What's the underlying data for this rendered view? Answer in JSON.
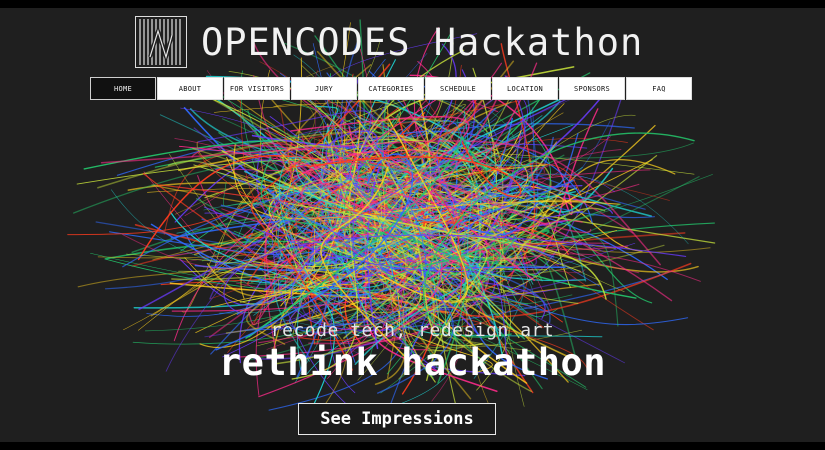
{
  "header": {
    "logo_icon": "striped-square-logo-icon",
    "title": "OPENCODES Hackathon"
  },
  "nav": {
    "items": [
      {
        "label": "HOME",
        "active": true
      },
      {
        "label": "ABOUT",
        "active": false
      },
      {
        "label": "FOR VISITORS",
        "active": false
      },
      {
        "label": "JURY",
        "active": false
      },
      {
        "label": "CATEGORIES",
        "active": false
      },
      {
        "label": "SCHEDULE",
        "active": false
      },
      {
        "label": "LOCATION",
        "active": false
      },
      {
        "label": "SPONSORS",
        "active": false
      },
      {
        "label": "FAQ",
        "active": false
      }
    ]
  },
  "hero": {
    "tagline": "recode tech, redesign art",
    "headline": "rethink hackathon",
    "cta_label": "See Impressions"
  },
  "colors": {
    "background": "#1f1f1f",
    "nav_background": "#ffffff",
    "nav_active": "#111111",
    "text": "#ffffff",
    "art_palette": [
      "#c8e23a",
      "#2f6bff",
      "#ff3b1f",
      "#1fd6d6",
      "#ff2b8a",
      "#ffd21f",
      "#24c46a",
      "#6a3bff"
    ]
  }
}
